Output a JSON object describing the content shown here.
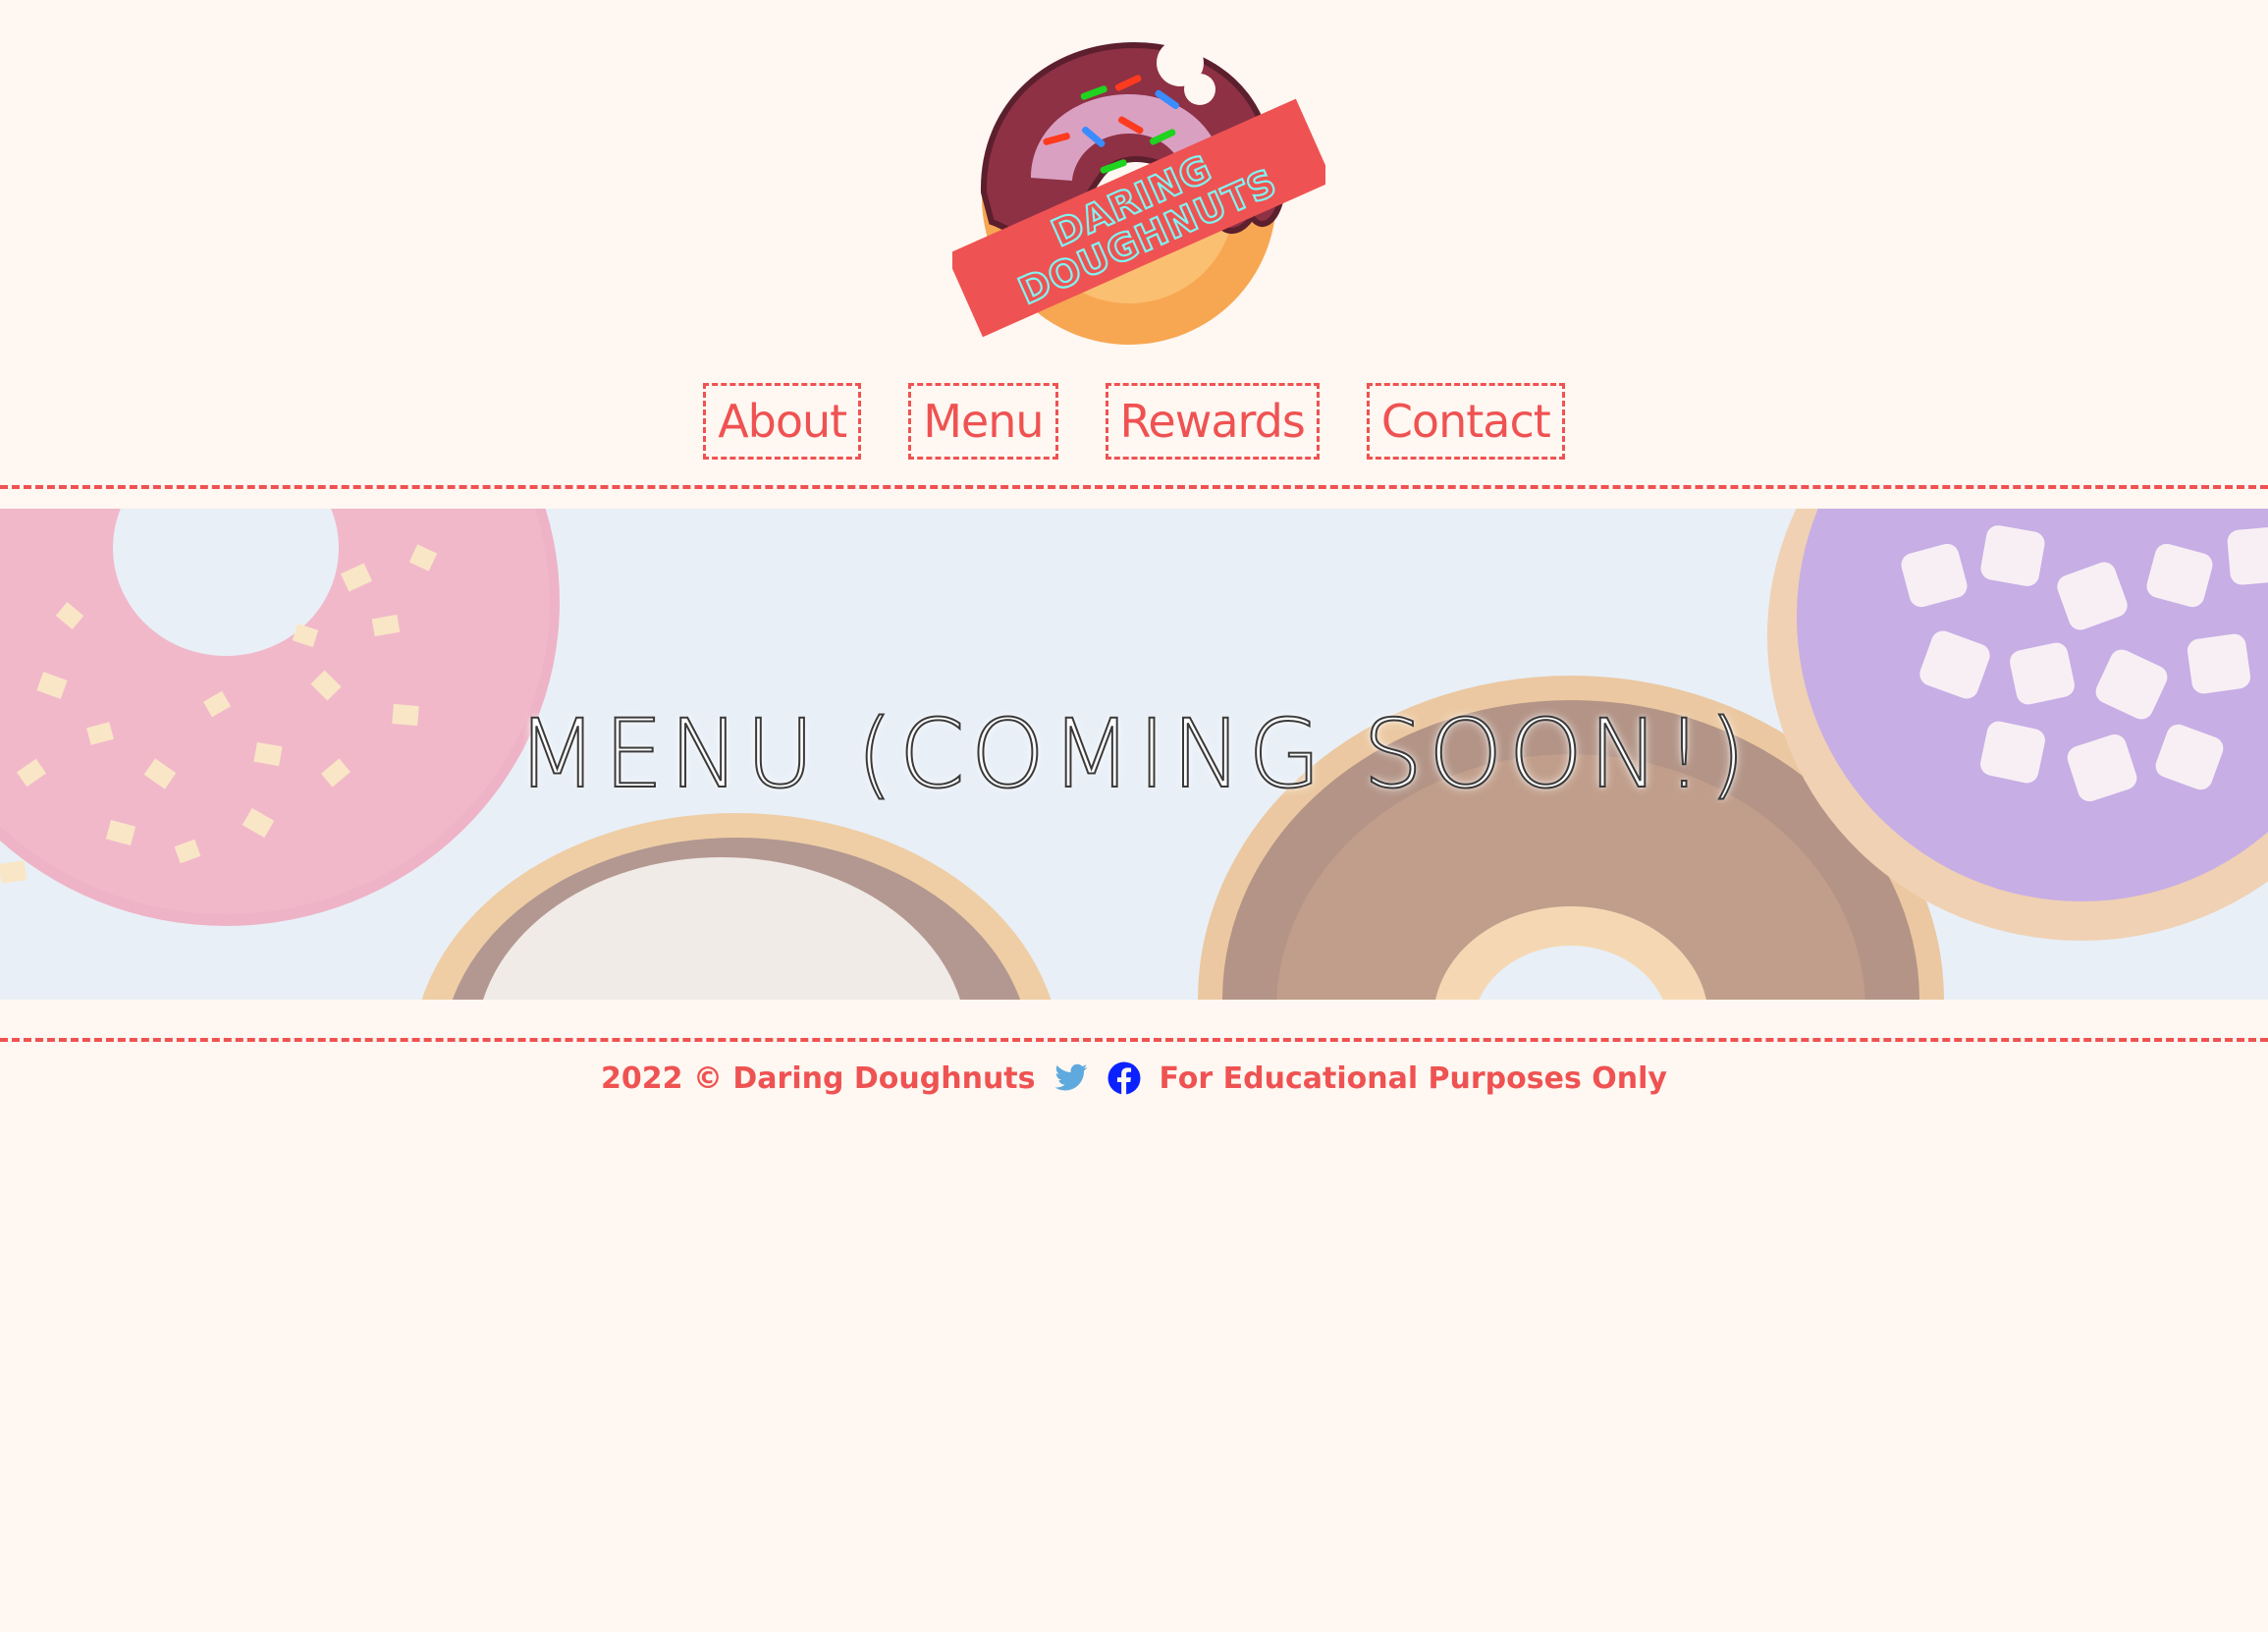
{
  "brand": {
    "logo_alt": "Daring Doughnuts logo",
    "logo_text_line1": "DARING",
    "logo_text_line2": "DOUGHNUTS"
  },
  "nav": {
    "items": [
      {
        "label": "About",
        "name": "nav-about"
      },
      {
        "label": "Menu",
        "name": "nav-menu"
      },
      {
        "label": "Rewards",
        "name": "nav-rewards"
      },
      {
        "label": "Contact",
        "name": "nav-contact"
      }
    ]
  },
  "hero": {
    "title": "MENU (COMING SOON!)"
  },
  "footer": {
    "copyright": "2022 © Daring Doughnuts",
    "disclaimer": "For Educational Purposes Only",
    "social": [
      {
        "icon": "twitter-icon",
        "color": "#5ea9dd"
      },
      {
        "icon": "facebook-icon",
        "color": "#0b22ff"
      }
    ]
  },
  "colors": {
    "accent": "#ef5252",
    "background": "#fff7f1"
  }
}
